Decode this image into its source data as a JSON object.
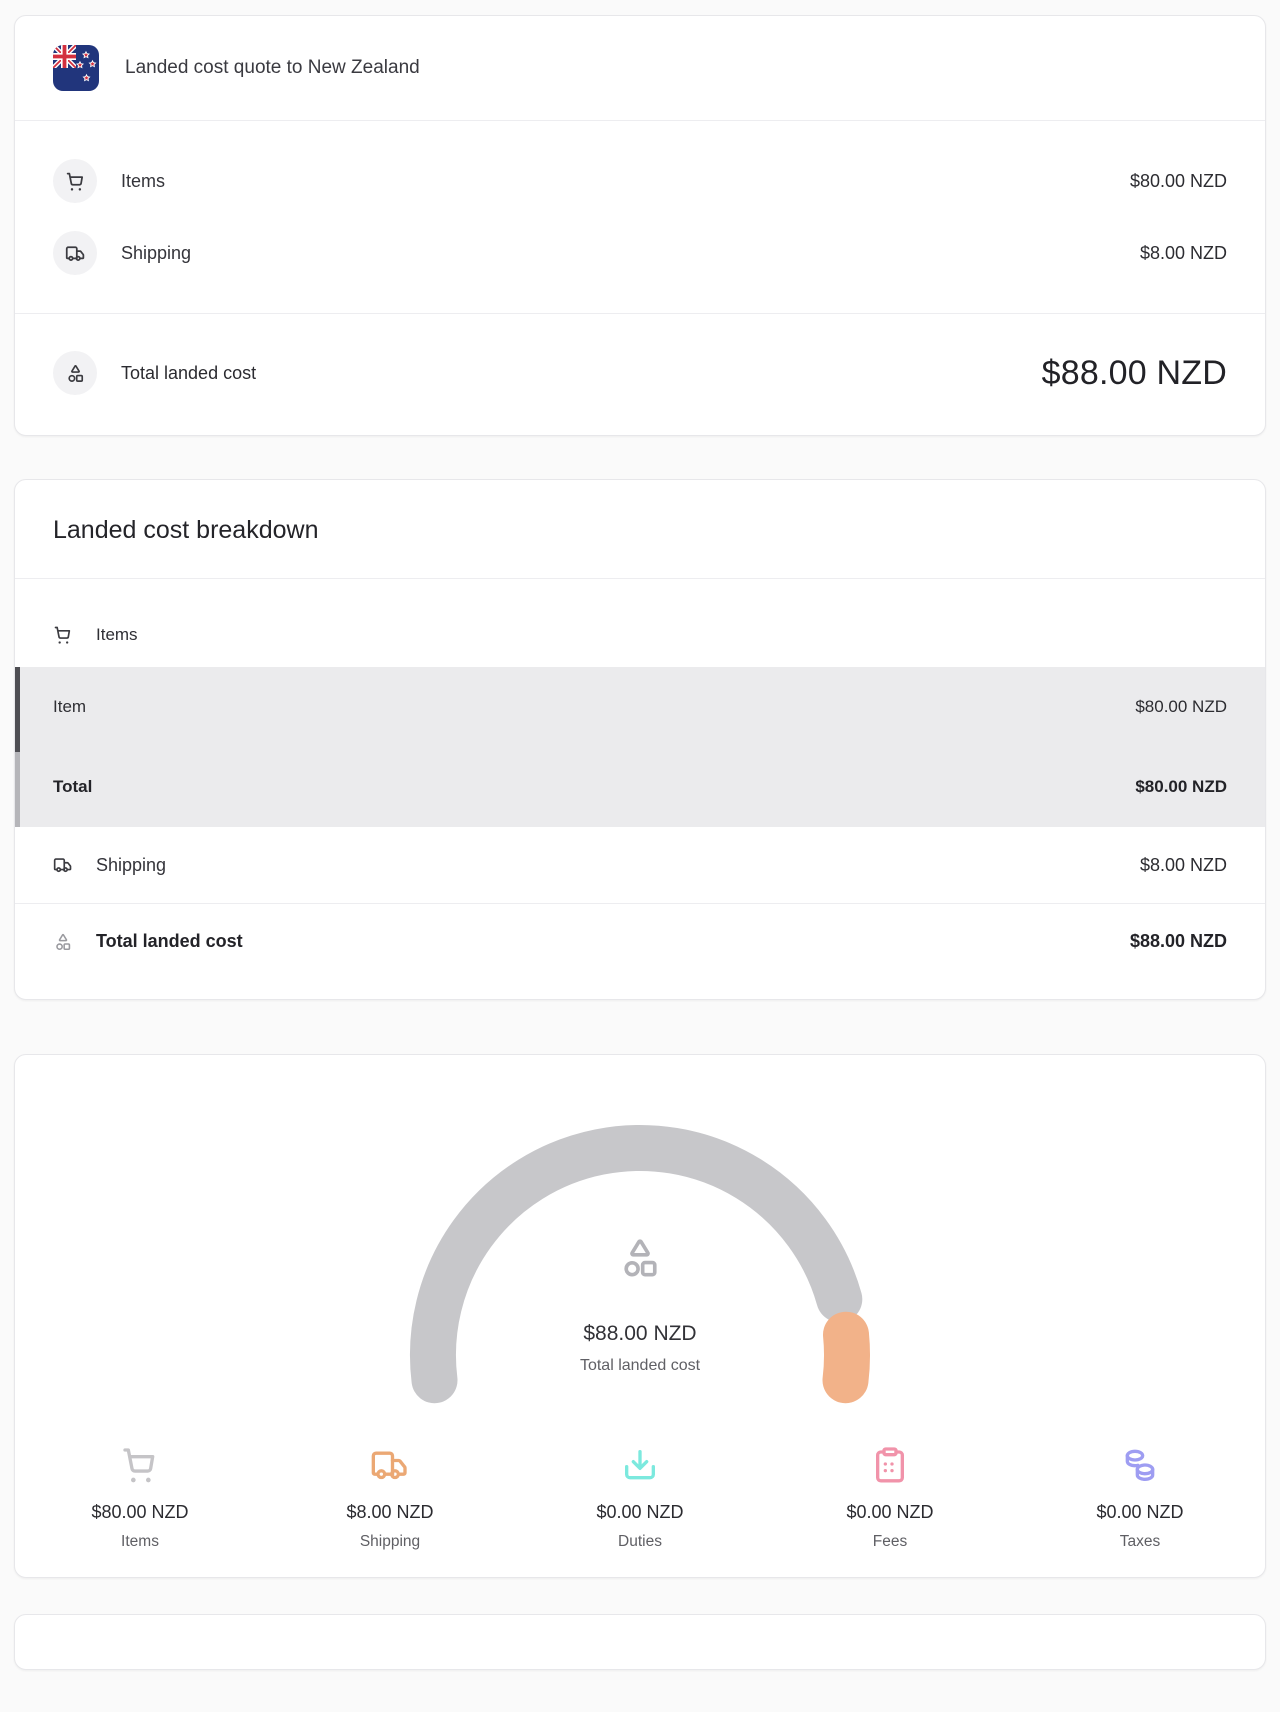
{
  "quote_card": {
    "title": "Landed cost quote to New Zealand",
    "rows": [
      {
        "label": "Items",
        "amount": "$80.00 NZD"
      },
      {
        "label": "Shipping",
        "amount": "$8.00 NZD"
      }
    ],
    "total": {
      "label": "Total landed cost",
      "amount": "$88.00 NZD"
    }
  },
  "breakdown_card": {
    "title": "Landed cost breakdown",
    "section_label": "Items",
    "item_rows": [
      {
        "label": "Item",
        "amount": "$80.00 NZD"
      },
      {
        "label": "Total",
        "amount": "$80.00 NZD"
      }
    ],
    "shipping_row": {
      "label": "Shipping",
      "amount": "$8.00 NZD"
    },
    "total_row": {
      "label": "Total landed cost",
      "amount": "$88.00 NZD"
    }
  },
  "chart_data": {
    "type": "gauge",
    "center_value": "$88.00 NZD",
    "center_label": "Total landed cost",
    "total": 88,
    "currency": "NZD",
    "start_deg": 187,
    "end_deg": -7,
    "gap_deg": 10,
    "track_colors": {
      "items_arc": "#c7c7ca",
      "shipping_arc": "#f2b289"
    },
    "segments": [
      {
        "label": "Items",
        "value": 80,
        "amount": "$80.00 NZD",
        "color": "#c7c7ca",
        "icon_color": "#c5c4c7",
        "icon": "cart-icon"
      },
      {
        "label": "Shipping",
        "value": 8,
        "amount": "$8.00 NZD",
        "color": "#f2b289",
        "icon_color": "#eba874",
        "icon": "truck-icon"
      },
      {
        "label": "Duties",
        "value": 0,
        "amount": "$0.00 NZD",
        "color": "#7ce9de",
        "icon_color": "#7ce9de",
        "icon": "download-tray-icon"
      },
      {
        "label": "Fees",
        "value": 0,
        "amount": "$0.00 NZD",
        "color": "#f193aa",
        "icon_color": "#f193aa",
        "icon": "clipboard-icon"
      },
      {
        "label": "Taxes",
        "value": 0,
        "amount": "$0.00 NZD",
        "color": "#9e9df2",
        "icon_color": "#9e9df2",
        "icon": "coins-icon"
      }
    ]
  }
}
